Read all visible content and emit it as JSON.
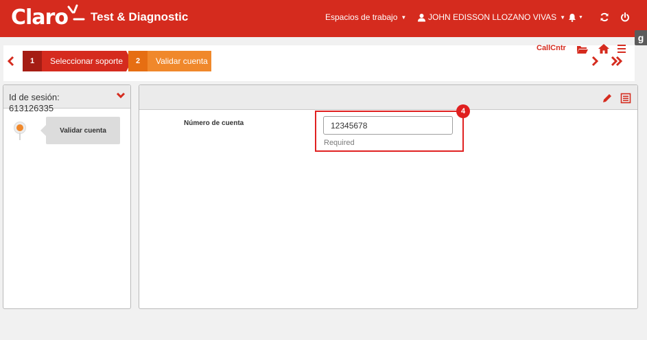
{
  "header": {
    "brand": "Claro",
    "app_title": "Test & Diagnostic",
    "workspaces_label": "Espacios de trabajo",
    "user_name": "JOHN EDISSON LLOZANO VIVAS",
    "side_tab_letter": "g"
  },
  "steps": [
    {
      "number": "1",
      "label": "Seleccionar soporte",
      "color": "#d52b1e"
    },
    {
      "number": "2",
      "label": "Validar cuenta",
      "color": "#f0882b"
    }
  ],
  "toolbar": {
    "callcntr_label": "CallCntr"
  },
  "left_panel": {
    "session_label": "Id de sesión:",
    "session_id": "613126335",
    "timeline": [
      {
        "label": "Validar cuenta"
      }
    ]
  },
  "form": {
    "account_label": "Número de cuenta",
    "account_value": "12345678",
    "helper_text": "Required",
    "badge_number": "4"
  },
  "icons": {
    "header": [
      "user-icon",
      "bell-icon",
      "refresh-icon",
      "power-icon"
    ],
    "toolbar": [
      "folder-icon",
      "home-icon",
      "menu-icon",
      "chevron-right-icon",
      "double-chevron-right-icon"
    ],
    "panel": [
      "chevron-down-icon",
      "pencil-icon",
      "list-icon"
    ]
  },
  "colors": {
    "brand_red": "#d52b1e",
    "step_orange": "#f0882b",
    "highlight_red": "#e02020"
  }
}
